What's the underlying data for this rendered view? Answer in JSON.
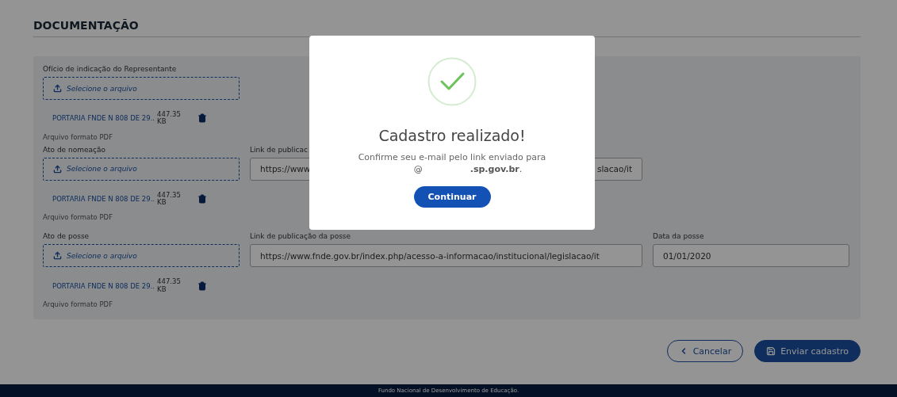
{
  "section_title": "DOCUMENTAÇÃO",
  "documents": [
    {
      "label": "Ofício de indicação do Representante",
      "upload_placeholder": "Selecione o arquivo",
      "file_name": "PORTARIA FNDE N 808 DE 29..",
      "file_size": "447.35",
      "file_unit": "KB",
      "format_note": "Arquivo formato PDF"
    },
    {
      "label": "Ato de nomeação",
      "upload_placeholder": "Selecione o arquivo",
      "file_name": "PORTARIA FNDE N 808 DE 29..",
      "file_size": "447.35",
      "file_unit": "KB",
      "format_note": "Arquivo formato PDF",
      "link": {
        "label": "Link de publicac",
        "value_parts": [
          "https://www",
          "slacao/it"
        ]
      }
    },
    {
      "label": "Ato de posse",
      "upload_placeholder": "Selecione o arquivo",
      "file_name": "PORTARIA FNDE N 808 DE 29..",
      "file_size": "447.35",
      "file_unit": "KB",
      "format_note": "Arquivo formato PDF",
      "link": {
        "label": "Link de publicação da posse",
        "value_parts": [
          "https://www.fnde.gov.br/index.php/acesso-a-informacao/institucional/legislacao/it"
        ]
      },
      "date": {
        "label": "Data da posse",
        "value": "01/01/2020"
      }
    }
  ],
  "actions": {
    "cancel": "Cancelar",
    "submit": "Enviar cadastro"
  },
  "footer": "Fundo Nacional de Desenvolvimento de Educação.",
  "modal": {
    "title": "Cadastro realizado!",
    "message": "Confirme seu e-mail pelo link enviado para",
    "email_parts": [
      "@",
      "**.sp.gov.br**."
    ],
    "button": "Continuar"
  }
}
